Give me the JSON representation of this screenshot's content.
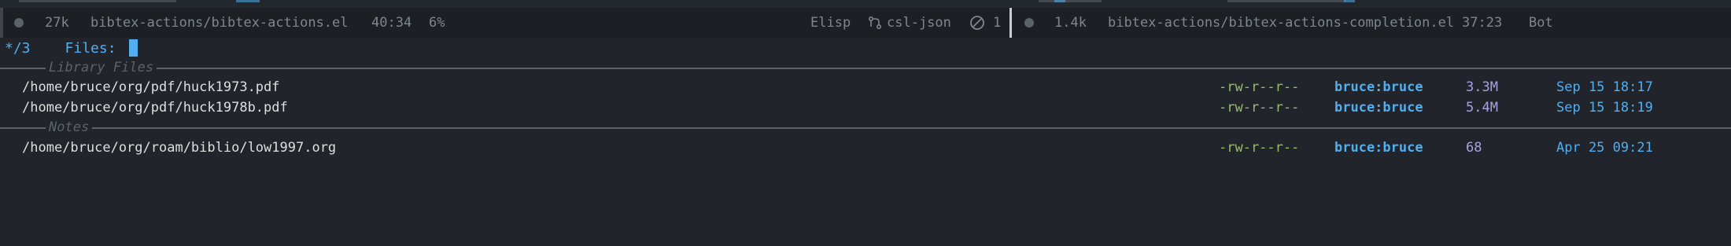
{
  "modeline_left": {
    "size": "27k",
    "buffer": "bibtex-actions/bibtex-actions.el",
    "position": "40:34",
    "percent": "6%",
    "major_mode": "Elisp",
    "branch": "csl-json",
    "checker_count": "1"
  },
  "modeline_right": {
    "size": "1.4k",
    "buffer": "bibtex-actions/bibtex-actions-completion.el",
    "position": "37:23",
    "percent": "Bot"
  },
  "prompt": {
    "count": "*/3",
    "label": "Files:"
  },
  "groups": [
    {
      "title": "Library Files",
      "rows": [
        {
          "path": "/home/bruce/org/pdf/huck1973.pdf",
          "perms": "-rw-r--r--",
          "owner": "bruce:bruce",
          "size": "3.3M",
          "date": "Sep 15 18:17"
        },
        {
          "path": "/home/bruce/org/pdf/huck1978b.pdf",
          "perms": "-rw-r--r--",
          "owner": "bruce:bruce",
          "size": "5.4M",
          "date": "Sep 15 18:19"
        }
      ]
    },
    {
      "title": "Notes",
      "rows": [
        {
          "path": "/home/bruce/org/roam/biblio/low1997.org",
          "perms": "-rw-r--r--",
          "owner": "bruce:bruce",
          "size": "68",
          "date": "Apr 25 09:21"
        }
      ]
    }
  ],
  "colors": {
    "background": "#21242b",
    "modeline_bg": "#1c1f24",
    "accent": "#51afef",
    "permissions": "#98be65",
    "size": "#a9a1e1",
    "group_title": "#5b6268"
  }
}
